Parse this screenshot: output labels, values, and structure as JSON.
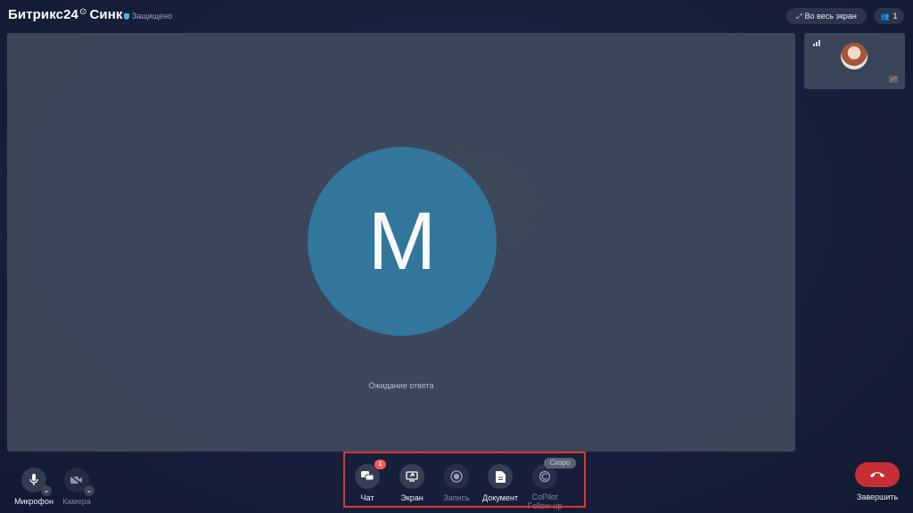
{
  "header": {
    "app_name": "Битрикс24",
    "clock_icon": "clock-icon",
    "product": "Синк",
    "secure_label": "Защищено",
    "fullscreen_label": "Во весь экран",
    "participants_count": "1"
  },
  "stage": {
    "avatar_letter": "M",
    "avatar_color": "#33799f",
    "status_text": "Ожидание ответа"
  },
  "controls": {
    "microphone": "Микрофон",
    "camera": "Камера",
    "chat": "Чат",
    "chat_badge": "1",
    "screen": "Экран",
    "record": "Запись",
    "document": "Документ",
    "copilot": "CoPilot",
    "copilot_sub": "Follow-up",
    "soon_badge": "Скоро",
    "end": "Завершить"
  },
  "colors": {
    "accent_end": "#c52e34",
    "badge": "#ff5752",
    "highlight_border": "#e0362c"
  }
}
